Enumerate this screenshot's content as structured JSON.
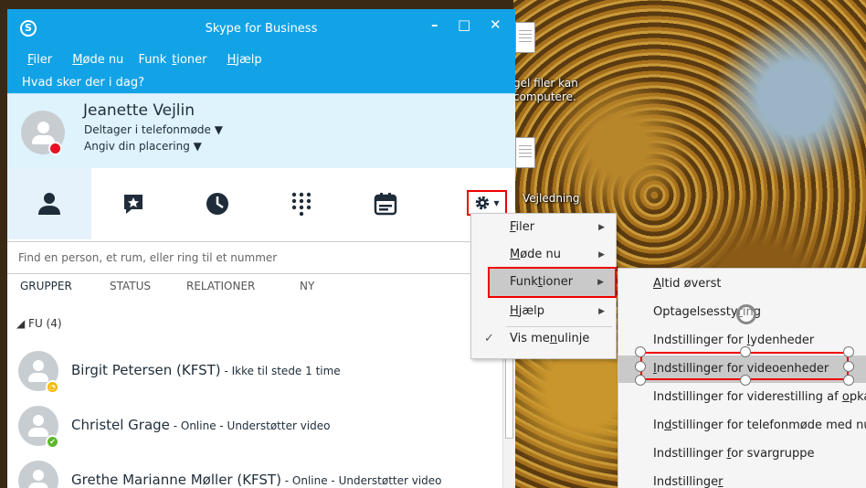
{
  "window": {
    "title": "Skype for Business",
    "logo_glyph": "S",
    "minimize_glyph": "–",
    "maximize_glyph": "□",
    "close_glyph": "✕"
  },
  "menubar": {
    "items": [
      {
        "pre": "",
        "key": "F",
        "post": "iler"
      },
      {
        "pre": "",
        "key": "M",
        "post": "øde nu"
      },
      {
        "pre": "Funk",
        "key": "t",
        "post": "ioner"
      },
      {
        "pre": "",
        "key": "H",
        "post": "jælp"
      }
    ]
  },
  "status_question": "Hvad sker der i dag?",
  "profile": {
    "name": "Jeanette Vejlin",
    "status": "Deltager i telefonmøde",
    "location": "Angiv din placering",
    "caret": "▼",
    "presence_color": "#e81123"
  },
  "nav_tabs": [
    {
      "name": "contacts-tab",
      "icon": "person-icon"
    },
    {
      "name": "chat-tab",
      "icon": "chat-star-icon"
    },
    {
      "name": "history-tab",
      "icon": "clock-icon"
    },
    {
      "name": "dialpad-tab",
      "icon": "dialpad-icon"
    },
    {
      "name": "meetings-tab",
      "icon": "calendar-icon"
    }
  ],
  "gear": {
    "icon": "gear-icon",
    "caret": "▾"
  },
  "search": {
    "placeholder": "Find en person, et rum, eller ring til et nummer"
  },
  "list_tabs": [
    "GRUPPER",
    "STATUS",
    "RELATIONER",
    "NY"
  ],
  "group": {
    "header": "◢ FU (4)"
  },
  "contacts": [
    {
      "name": "Birgit Petersen (KFST)",
      "note": " - Ikke til stede 1 time",
      "badge_color": "#f5b800",
      "badge_glyph": "◔"
    },
    {
      "name": "Christel Grage",
      "note": " - Online - Understøtter video",
      "badge_color": "#5cb82a",
      "badge_glyph": "✔"
    },
    {
      "name": "Grethe Marianne Møller (KFST)",
      "note": " - Online - Understøtter video",
      "badge_color": "#5cb82a",
      "badge_glyph": "✔"
    }
  ],
  "gear_menu": {
    "items": [
      {
        "pre": "",
        "key": "F",
        "post": "iler",
        "arrow": "▶"
      },
      {
        "pre": "",
        "key": "M",
        "post": "øde nu",
        "arrow": "▶"
      },
      {
        "pre": "Funk",
        "key": "t",
        "post": "ioner",
        "arrow": "▶"
      },
      {
        "pre": "",
        "key": "H",
        "post": "jælp",
        "arrow": "▶"
      },
      {
        "pre": "Vis me",
        "key": "n",
        "post": "ulinje",
        "check": "✓"
      }
    ]
  },
  "sub_menu": {
    "items": [
      {
        "pre": "",
        "key": "A",
        "post": "ltid øverst"
      },
      {
        "pre": "Optagelsessty",
        "key": "r",
        "post": "ing"
      },
      {
        "pre": "Indstillinger for ",
        "key": "l",
        "post": "ydenheder"
      },
      {
        "pre": "",
        "key": "I",
        "post": "ndstillinger for videoenheder"
      },
      {
        "pre": "Indstillinger for viderestilling af ",
        "key": "o",
        "post": "pkald"
      },
      {
        "pre": "In",
        "key": "d",
        "post": "stillinger for telefonmøde med nummer"
      },
      {
        "pre": "Indstillinger ",
        "key": "f",
        "post": "or svargruppe"
      },
      {
        "pre": "Indstillinge",
        "key": "r",
        "post": ""
      }
    ]
  },
  "desktop": {
    "label1": "gel filer kan\ncomputere.",
    "label2": "Vejledning"
  }
}
